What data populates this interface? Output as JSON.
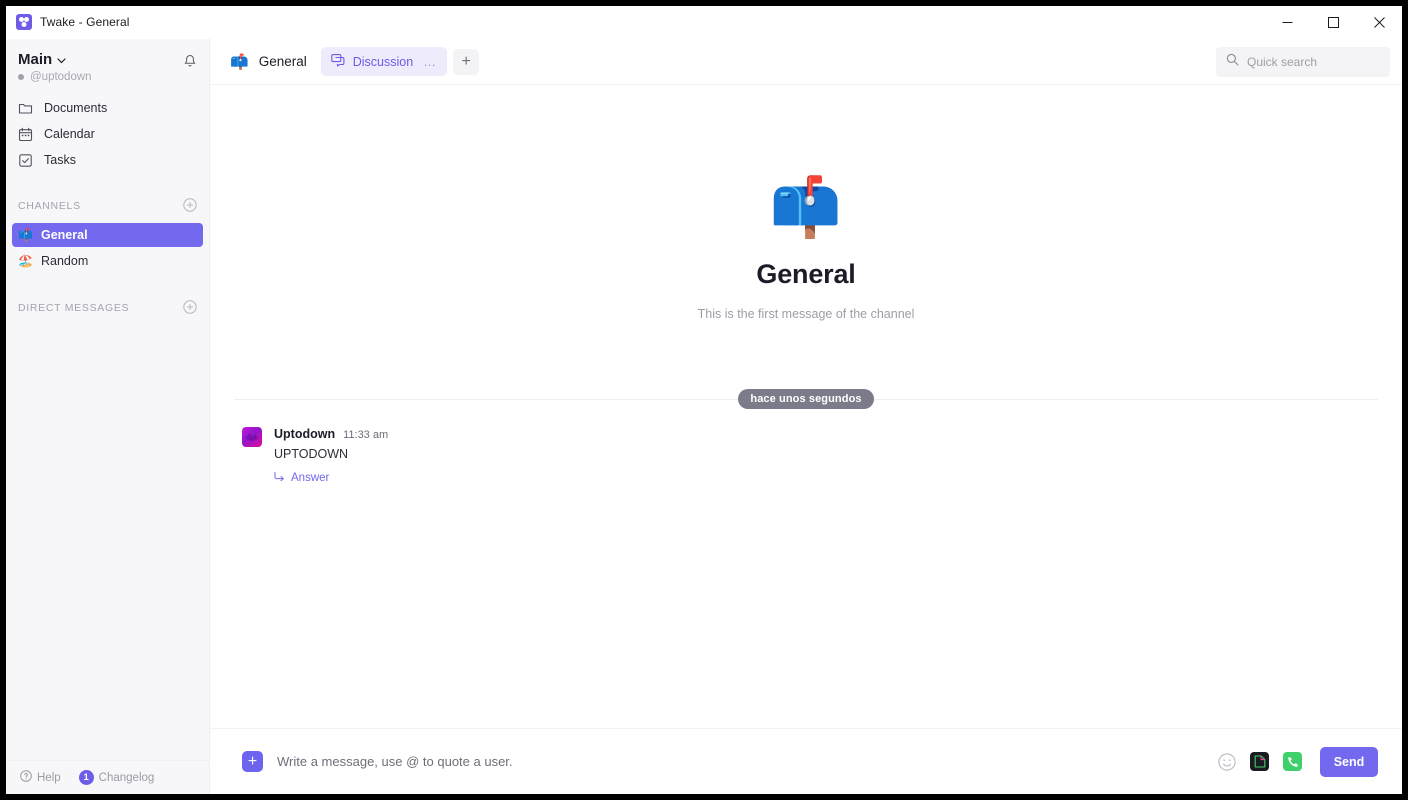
{
  "window": {
    "title": "Twake - General",
    "app_icon": "twake-logo-icon",
    "controls": {
      "minimize": "minimize-icon",
      "maximize": "maximize-icon",
      "close": "close-icon"
    }
  },
  "sidebar": {
    "workspace": {
      "name": "Main",
      "handle": "@uptodown",
      "chevron": "chevron-down-icon",
      "bell": "bell-icon"
    },
    "nav": [
      {
        "label": "Documents",
        "icon": "folder-icon"
      },
      {
        "label": "Calendar",
        "icon": "calendar-icon"
      },
      {
        "label": "Tasks",
        "icon": "task-check-icon"
      }
    ],
    "sections": [
      {
        "title": "CHANNELS",
        "add_icon": "plus-circle-icon",
        "items": [
          {
            "label": "General",
            "emoji": "📫",
            "active": true
          },
          {
            "label": "Random",
            "emoji": "🏖️",
            "active": false
          }
        ]
      },
      {
        "title": "DIRECT MESSAGES",
        "add_icon": "plus-circle-icon",
        "items": []
      }
    ],
    "footer": {
      "help_label": "Help",
      "help_icon": "help-circle-icon",
      "changelog_label": "Changelog",
      "changelog_badge": "1"
    }
  },
  "topbar": {
    "channel": {
      "name": "General",
      "emoji": "📫"
    },
    "tabs": [
      {
        "label": "Discussion",
        "icon": "chat-bubble-icon",
        "more": "…",
        "active": true
      }
    ],
    "add_tab": "+",
    "search": {
      "placeholder": "Quick search",
      "value": "",
      "icon": "search-icon"
    }
  },
  "main": {
    "welcome": {
      "emoji": "📫",
      "title": "General",
      "subtitle": "This is the first message of the channel"
    },
    "date_divider": "hace unos segundos",
    "messages": [
      {
        "author": "Uptodown",
        "time": "11:33 am",
        "text": "UPTODOWN",
        "answer_label": "Answer",
        "answer_icon": "reply-arrow-icon",
        "avatar": "uptodown-avatar"
      }
    ]
  },
  "composer": {
    "add_icon": "plus-square-icon",
    "placeholder": "Write a message, use @ to quote a user.",
    "value": "",
    "actions": [
      {
        "name": "emoji-icon"
      },
      {
        "name": "file-attachment-icon"
      },
      {
        "name": "phone-call-icon"
      }
    ],
    "send_label": "Send"
  },
  "colors": {
    "accent": "#7269EF",
    "accent_soft": "#EDEBFC",
    "sidebar_bg": "#F7F7F9",
    "date_pill": "#7B7B89",
    "phone_green": "#3FD06B"
  }
}
